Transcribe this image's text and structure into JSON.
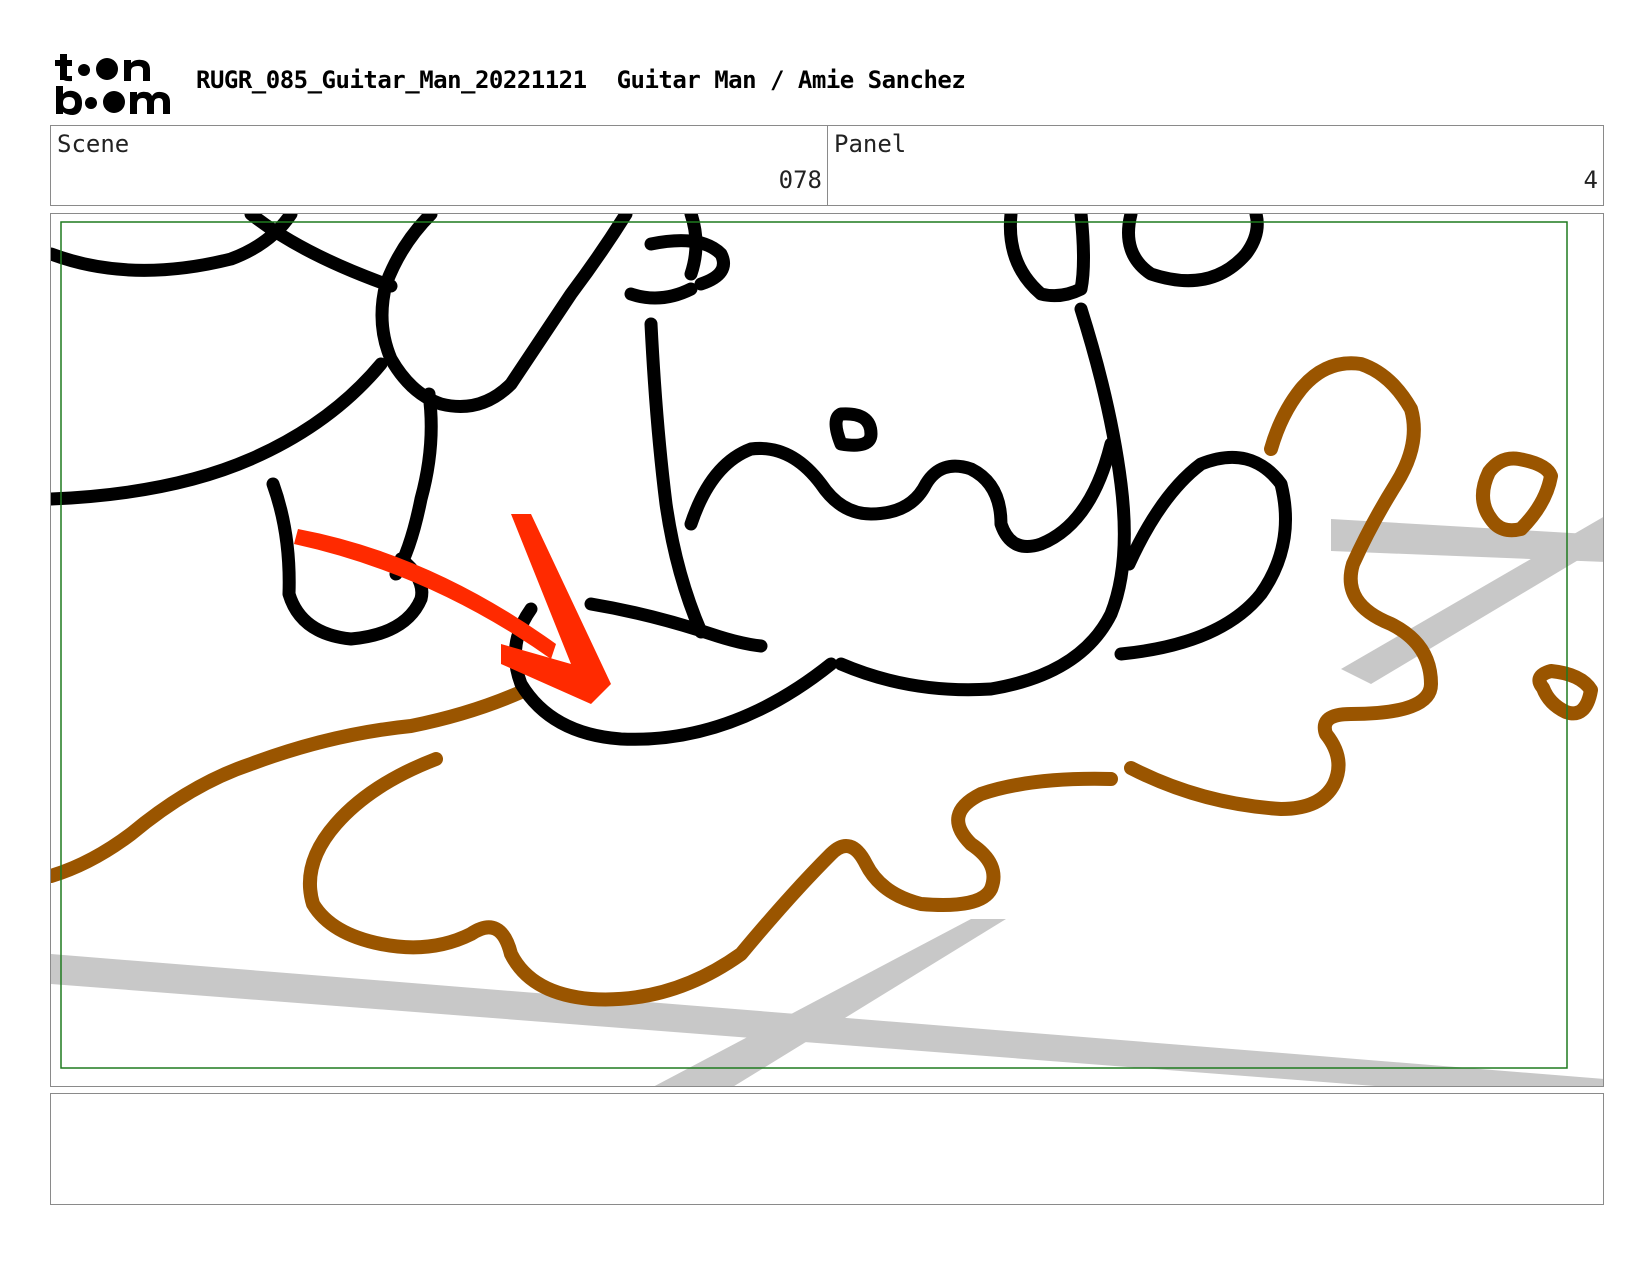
{
  "header": {
    "logo_text": "toon boom",
    "project_id": "RUGR_085_Guitar_Man_20221121",
    "project_title": "Guitar Man / Amie Sanchez"
  },
  "scene": {
    "label": "Scene",
    "value": "078"
  },
  "panel": {
    "label": "Panel",
    "value": "4"
  },
  "colors": {
    "ink": "#000000",
    "splash": "#9a5500",
    "arrow": "#ff2a00",
    "floor_shadow": "#c8c8c8",
    "safe_frame": "#1f7a1f"
  },
  "notes": {
    "text": ""
  }
}
